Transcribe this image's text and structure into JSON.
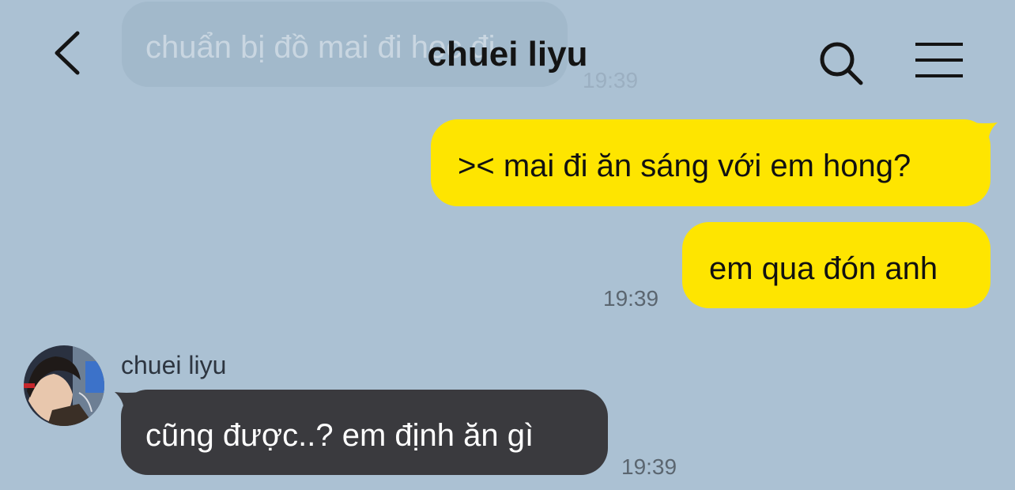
{
  "header": {
    "title": "chuei liyu",
    "back_icon": "chevron-left-icon",
    "search_icon": "search-icon",
    "menu_icon": "menu-icon"
  },
  "previous_message": {
    "text": "chuẩn bị đồ mai đi học đi",
    "time": "19:39"
  },
  "messages": [
    {
      "direction": "outgoing",
      "text": ">< mai đi ăn sáng với em hong?"
    },
    {
      "direction": "outgoing",
      "text": "em qua đón anh",
      "time": "19:39"
    },
    {
      "direction": "incoming",
      "sender": "chuei liyu",
      "text": "cũng được..? em định ăn gì",
      "time": "19:39"
    }
  ],
  "colors": {
    "background": "#abc1d3",
    "outgoing_bubble": "#fee500",
    "incoming_bubble": "#3a3a3e"
  }
}
